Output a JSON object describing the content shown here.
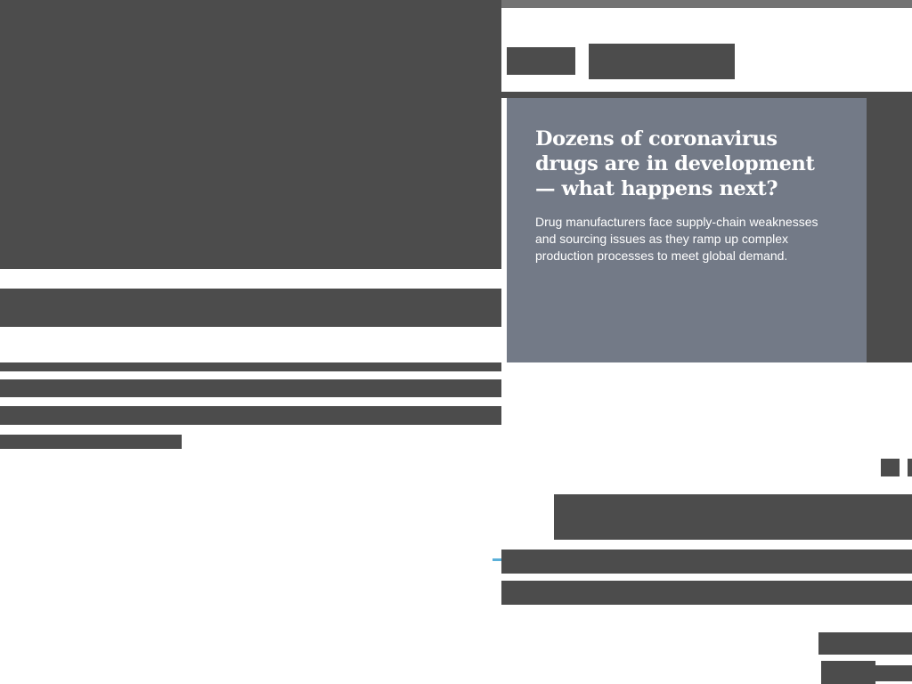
{
  "colors": {
    "placeholder": "#4c4c4c",
    "top_bar": "#737373",
    "card_background": "#737a87",
    "card_text": "#ffffff",
    "accent": "#5bb0d9"
  },
  "featured_card": {
    "title": "Dozens of coronavirus drugs are in development — what happens next?",
    "description": "Drug manufacturers face supply-chain weaknesses and sourcing issues as they ramp up complex production processes to meet global demand."
  }
}
